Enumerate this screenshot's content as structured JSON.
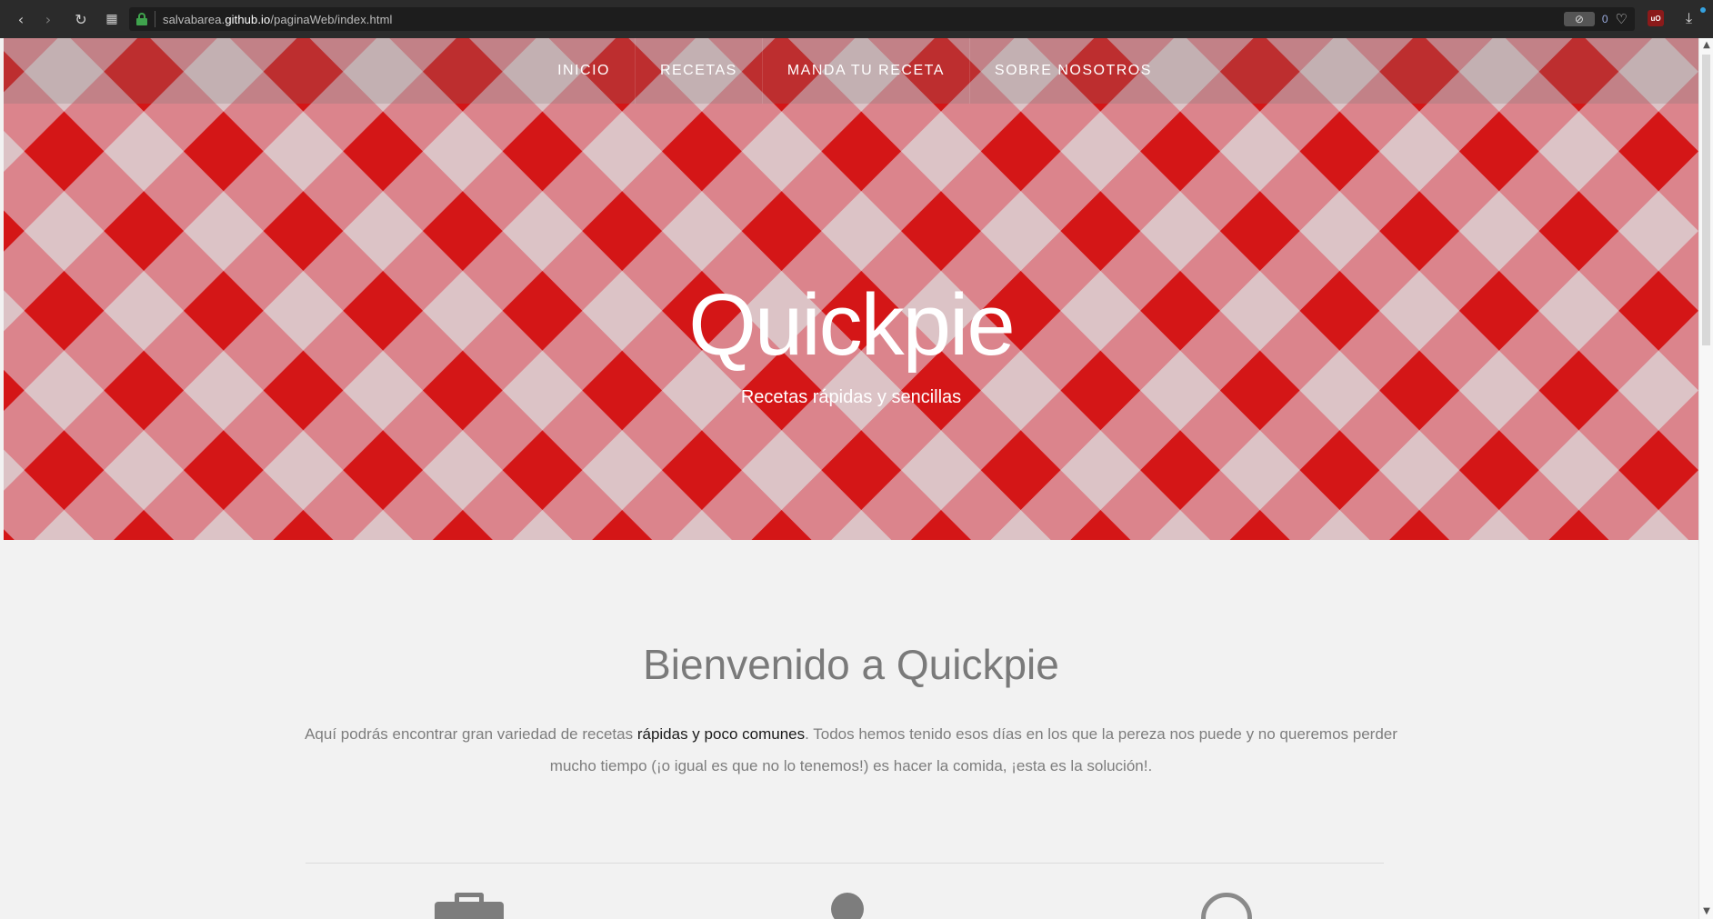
{
  "browser": {
    "url_prefix": "salvabarea.",
    "url_host": "github.io",
    "url_path": "/paginaWeb/index.html",
    "blocked_count": "0",
    "extension_badge": "uO"
  },
  "nav": {
    "items": [
      {
        "label": "INICIO"
      },
      {
        "label": "RECETAS"
      },
      {
        "label": "MANDA TU RECETA"
      },
      {
        "label": "SOBRE NOSOTROS"
      }
    ]
  },
  "hero": {
    "title": "Quickpie",
    "subtitle": "Recetas rápidas y sencillas"
  },
  "welcome": {
    "title": "Bienvenido a Quickpie",
    "intro_before": "Aquí podrás encontrar gran variedad de recetas ",
    "intro_highlight": "rápidas y poco comunes",
    "intro_after": ". Todos hemos tenido esos días en los que la pereza nos puede y no queremos perder mucho tiempo (¡o igual es que no lo tenemos!) es hacer la comida, ¡esta es la solución!."
  },
  "colors": {
    "checker_dark": "#d40f0f",
    "checker_mid": "#d74a52",
    "checker_light": "#ddd4d6",
    "checker_pink": "#dc8d94",
    "page_bg": "#f2f2f2",
    "text_gray": "#7a7a7a"
  },
  "icons": [
    "briefcase-icon",
    "clock-icon",
    "globe-icon"
  ]
}
